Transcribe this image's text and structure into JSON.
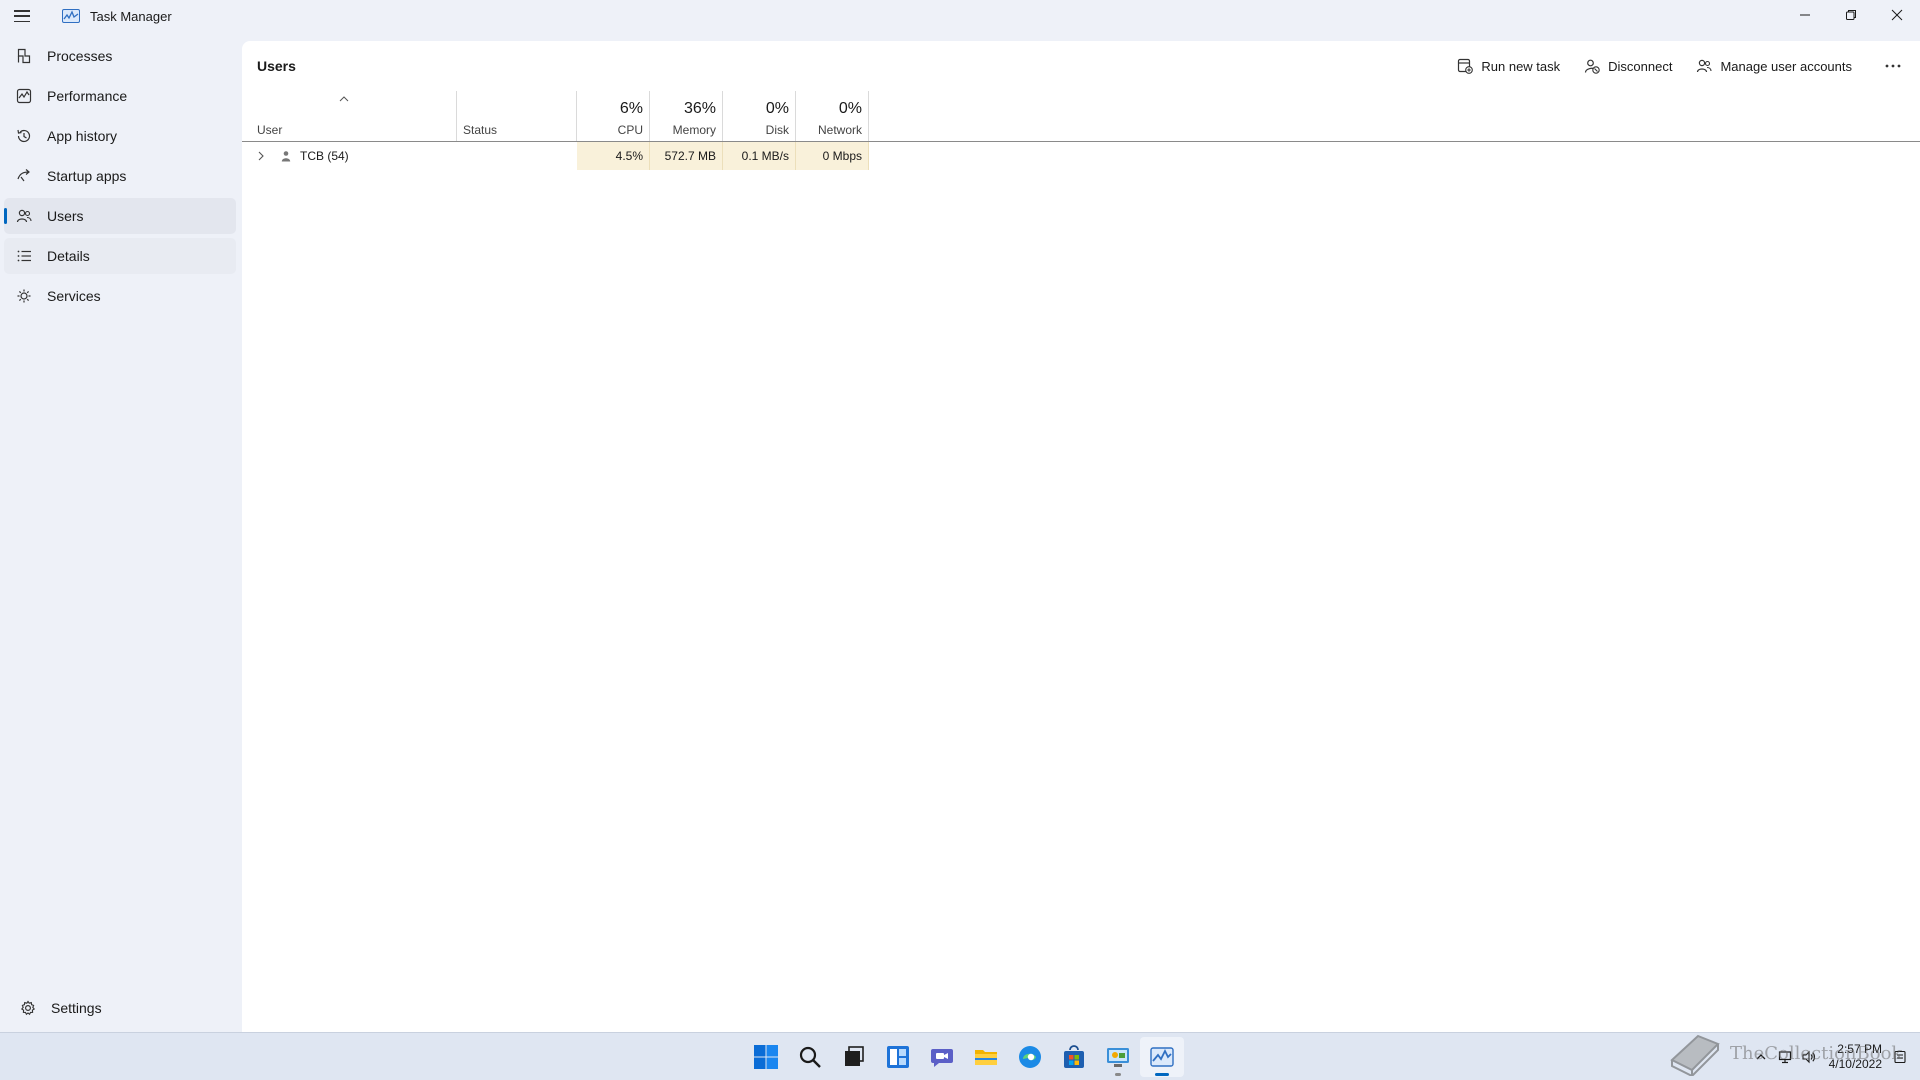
{
  "window": {
    "title": "Task Manager",
    "icon": "task-manager-icon"
  },
  "sidebar": {
    "items": [
      {
        "label": "Processes",
        "icon": "processes-icon"
      },
      {
        "label": "Performance",
        "icon": "performance-icon"
      },
      {
        "label": "App history",
        "icon": "app-history-icon"
      },
      {
        "label": "Startup apps",
        "icon": "startup-apps-icon"
      },
      {
        "label": "Users",
        "icon": "users-icon",
        "active": true
      },
      {
        "label": "Details",
        "icon": "details-icon"
      },
      {
        "label": "Services",
        "icon": "services-icon"
      }
    ],
    "settings": {
      "label": "Settings",
      "icon": "gear-icon"
    }
  },
  "main": {
    "title": "Users",
    "toolbar": {
      "run_new_task": "Run new task",
      "disconnect": "Disconnect",
      "manage_user_accounts": "Manage user accounts",
      "more": "more-options-icon"
    }
  },
  "table": {
    "columns": {
      "user": "User",
      "status": "Status",
      "cpu": {
        "percent": "6%",
        "label": "CPU"
      },
      "memory": {
        "percent": "36%",
        "label": "Memory"
      },
      "disk": {
        "percent": "0%",
        "label": "Disk"
      },
      "network": {
        "percent": "0%",
        "label": "Network"
      }
    },
    "rows": [
      {
        "user": "TCB (54)",
        "status": "",
        "cpu": "4.5%",
        "memory": "572.7 MB",
        "disk": "0.1 MB/s",
        "network": "0 Mbps"
      }
    ]
  },
  "taskbar": {
    "apps": [
      "start-icon",
      "search-icon",
      "task-view-icon",
      "widgets-icon",
      "chat-icon",
      "file-explorer-icon",
      "edge-icon",
      "store-icon",
      "control-panel-icon",
      "task-manager-icon"
    ],
    "clock": {
      "time": "2:57 PM",
      "date": "4/10/2022"
    }
  },
  "watermark": {
    "text": "TheCollectionBook"
  },
  "colors": {
    "accent": "#0067c0",
    "heat_cell": "#f9f1da",
    "background": "#eef1f8"
  }
}
